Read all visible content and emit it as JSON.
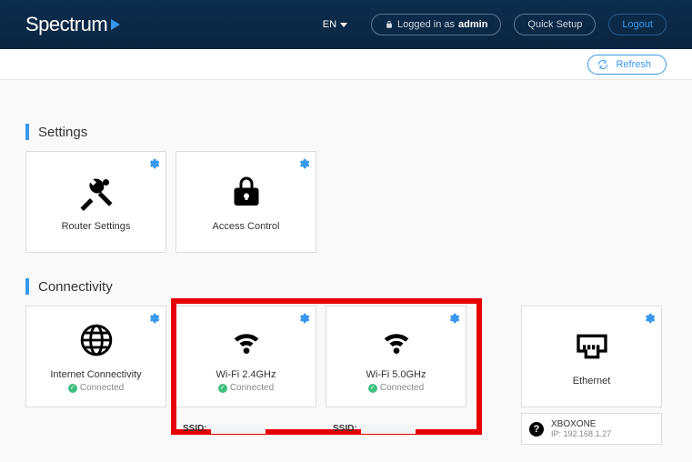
{
  "header": {
    "brand": "Spectrum",
    "lang_label": "EN",
    "logged_in_prefix": "Logged in as",
    "logged_in_user": "admin",
    "quick_setup": "Quick Setup",
    "logout": "Logout"
  },
  "subbar": {
    "refresh": "Refresh"
  },
  "sections": {
    "settings": "Settings",
    "connectivity": "Connectivity"
  },
  "cards": {
    "router_settings": "Router Settings",
    "access_control": "Access Control",
    "internet_connectivity": "Internet Connectivity",
    "wifi24": "Wi-Fi 2.4GHz",
    "wifi50": "Wi-Fi 5.0GHz",
    "ethernet": "Ethernet",
    "connected": "Connected"
  },
  "ssid": {
    "label": "SSID:"
  },
  "device": {
    "name": "XBOXONE",
    "ip_label": "IP:",
    "ip": "192.168.1.27"
  }
}
